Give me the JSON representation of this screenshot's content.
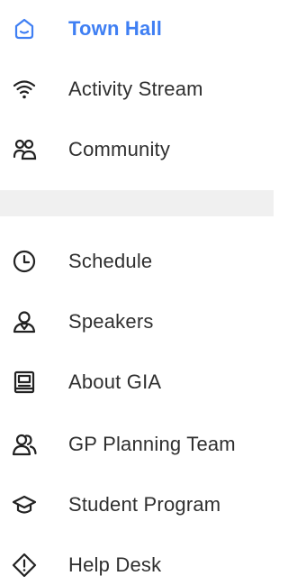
{
  "colors": {
    "accent": "#3f7ff3",
    "text": "#2f2f2f",
    "divider": "#f0f0f0"
  },
  "nav_primary": [
    {
      "label": "Town Hall",
      "icon": "home-bubble-icon",
      "active": true
    },
    {
      "label": "Activity Stream",
      "icon": "wifi-icon",
      "active": false
    },
    {
      "label": "Community",
      "icon": "people-icon",
      "active": false
    }
  ],
  "nav_secondary": [
    {
      "label": "Schedule",
      "icon": "clock-icon"
    },
    {
      "label": "Speakers",
      "icon": "speaker-person-icon"
    },
    {
      "label": "About GIA",
      "icon": "book-icon"
    },
    {
      "label": "GP Planning Team",
      "icon": "team-icon"
    },
    {
      "label": "Student Program",
      "icon": "graduation-cap-icon"
    },
    {
      "label": "Help Desk",
      "icon": "alert-diamond-icon"
    }
  ]
}
